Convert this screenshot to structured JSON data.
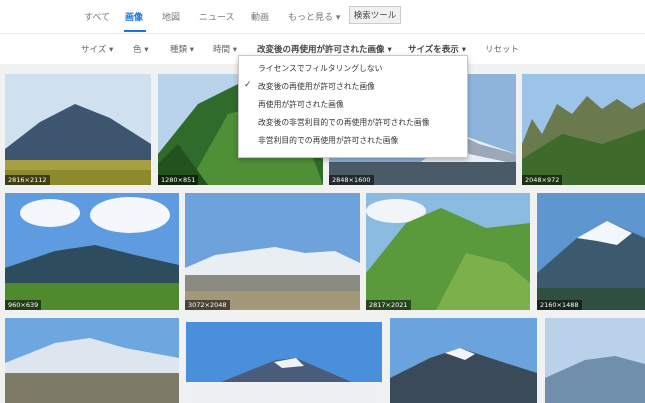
{
  "tabs": [
    {
      "label": "すべて"
    },
    {
      "label": "画像"
    },
    {
      "label": "地図"
    },
    {
      "label": "ニュース"
    },
    {
      "label": "動画"
    },
    {
      "label": "もっと見る ▾"
    }
  ],
  "tools_button": "検索ツール",
  "filters": [
    {
      "label": "サイズ ▾"
    },
    {
      "label": "色 ▾"
    },
    {
      "label": "種類 ▾"
    },
    {
      "label": "時間 ▾"
    },
    {
      "label": "改変後の再使用が許可された画像 ▾"
    },
    {
      "label": "サイズを表示 ▾"
    },
    {
      "label": "リセット"
    }
  ],
  "dropdown": {
    "items": [
      {
        "label": "ライセンスでフィルタリングしない"
      },
      {
        "label": "改変後の再使用が許可された画像",
        "checked": true
      },
      {
        "label": "再使用が許可された画像"
      },
      {
        "label": "改変後の非営利目的での再使用が許可された画像"
      },
      {
        "label": "非営利目的での再使用が許可された画像"
      }
    ],
    "check_glyph": "✓"
  },
  "images": [
    {
      "dims": "2816×2112"
    },
    {
      "dims": "1280×851"
    },
    {
      "dims": "2848×1600"
    },
    {
      "dims": "2048×972"
    },
    {
      "dims": "960×639"
    },
    {
      "dims": "3072×2048"
    },
    {
      "dims": "2817×2021"
    },
    {
      "dims": "2160×1488"
    },
    {
      "dims": ""
    },
    {
      "dims": ""
    },
    {
      "dims": ""
    },
    {
      "dims": ""
    }
  ],
  "colors": {
    "accent": "#1a73e8",
    "sky": "#7fb3e6",
    "grass": "#7d9a3a",
    "forest": "#2f6b2a"
  }
}
